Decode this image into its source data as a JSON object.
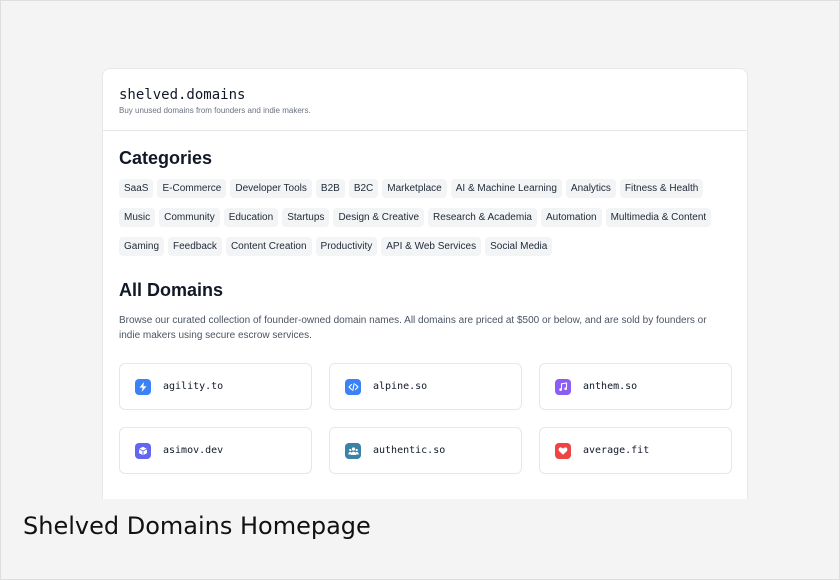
{
  "header": {
    "brand": "shelved.domains",
    "tagline": "Buy unused domains from founders and indie makers."
  },
  "categories": {
    "title": "Categories",
    "items": [
      "SaaS",
      "E-Commerce",
      "Developer Tools",
      "B2B",
      "B2C",
      "Marketplace",
      "AI & Machine Learning",
      "Analytics",
      "Fitness & Health",
      "Music",
      "Community",
      "Education",
      "Startups",
      "Design & Creative",
      "Research & Academia",
      "Automation",
      "Multimedia & Content",
      "Gaming",
      "Feedback",
      "Content Creation",
      "Productivity",
      "API & Web Services",
      "Social Media"
    ]
  },
  "all_domains": {
    "title": "All Domains",
    "description": "Browse our curated collection of founder-owned domain names. All domains are priced at $500 or below, and are sold by founders or indie makers using secure escrow services.",
    "domains": [
      {
        "name": "agility.to",
        "icon": "lightning-icon",
        "color": "#3b82f6"
      },
      {
        "name": "alpine.so",
        "icon": "code-icon",
        "color": "#3b82f6"
      },
      {
        "name": "anthem.so",
        "icon": "music-note-icon",
        "color": "#8b5cf6"
      },
      {
        "name": "asimov.dev",
        "icon": "cube-icon",
        "color": "#6366f1"
      },
      {
        "name": "authentic.so",
        "icon": "users-icon",
        "color": "#3b82a6"
      },
      {
        "name": "average.fit",
        "icon": "heart-icon",
        "color": "#ef4444"
      }
    ]
  },
  "caption": "Shelved Domains Homepage"
}
